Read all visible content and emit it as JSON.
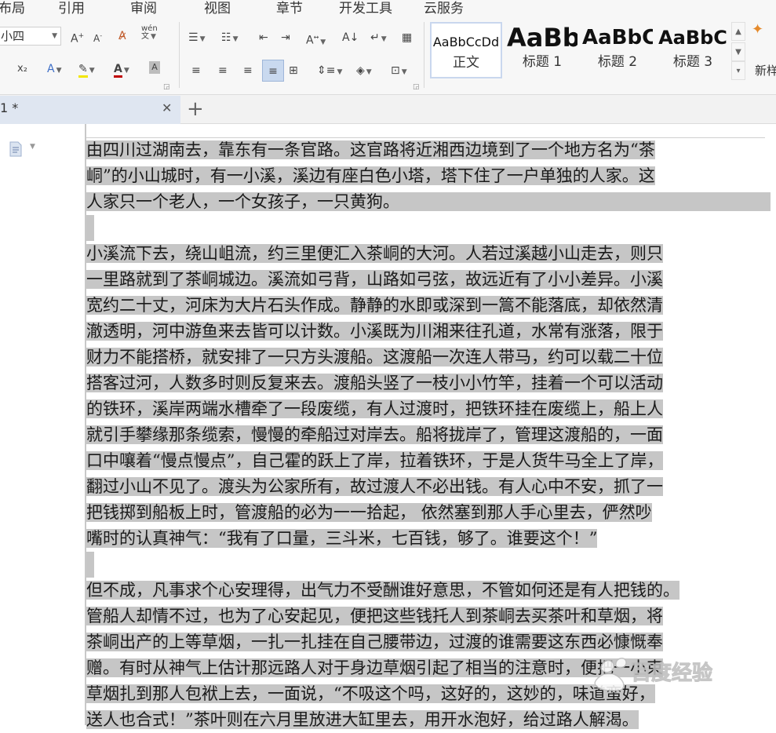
{
  "menu": [
    "布局",
    "引用",
    "审阅",
    "视图",
    "章节",
    "开发工具",
    "云服务"
  ],
  "ribbon": {
    "font_size": "小四",
    "pinyin_label": "wén",
    "superscript_label": "x₂",
    "styles": [
      {
        "preview": "AaBbCcDd",
        "name": "正文"
      },
      {
        "preview": "AaBb",
        "name": "标题 1"
      },
      {
        "preview": "AaBbC",
        "name": "标题 2"
      },
      {
        "preview": "AaBbC",
        "name": "标题 3"
      }
    ],
    "new_style_label": "新样"
  },
  "tab": {
    "title": "1 *"
  },
  "document": {
    "paragraphs": [
      [
        "由四川过湖南去，靠东有一条官路。这官路将近湘西边境到了一个地方名为“茶",
        "峒”的小山城时，有一小溪，溪边有座白色小塔，塔下住了一户单独的人家。这",
        "人家只一个老人，一个女孩子，一只黄狗。"
      ],
      [
        "小溪流下去，绕山岨流，约三里便汇入茶峒的大河。人若过溪越小山走去，则只",
        "一里路就到了茶峒城边。溪流如弓背，山路如弓弦，故远近有了小小差异。小溪",
        "宽约二十丈，河床为大片石头作成。静静的水即或深到一篙不能落底，却依然清",
        "澈透明，河中游鱼来去皆可以计数。小溪既为川湘来往孔道，水常有涨落，限于",
        "财力不能搭桥，就安排了一只方头渡船。这渡船一次连人带马，约可以载二十位",
        "搭客过河，人数多时则反复来去。渡船头竖了一枝小小竹竿，挂着一个可以活动",
        "的铁环，溪岸两端水槽牵了一段废缆，有人过渡时，把铁环挂在废缆上，船上人",
        "就引手攀缘那条缆索，慢慢的牵船过对岸去。船将拢岸了，管理这渡船的，一面",
        "口中嚷着“慢点慢点”，自己霍的跃上了岸，拉着铁环，于是人货牛马全上了岸，",
        "翻过小山不见了。渡头为公家所有，故过渡人不必出钱。有人心中不安，抓了一",
        "把钱掷到船板上时，管渡船的必为一一拾起， 依然塞到那人手心里去，俨然吵",
        "嘴时的认真神气：“我有了口量，三斗米，七百钱，够了。谁要这个！”"
      ],
      [
        "但不成，凡事求个心安理得，出气力不受酬谁好意思，不管如何还是有人把钱的。",
        "管船人却情不过，也为了心安起见，便把这些钱托人到茶峒去买茶叶和草烟，将",
        "茶峒出产的上等草烟，一扎一扎挂在自己腰带边，过渡的谁需要这东西必慷慨奉",
        "赠。有时从神气上估计那远路人对于身边草烟引起了相当的注意时，便把一小束",
        "草烟扎到那人包袱上去，一面说，“不吸这个吗，这好的，这妙的，味道蛮好，",
        "送人也合式！”茶叶则在六月里放进大缸里去，用开水泡好，给过路人解渴。"
      ]
    ]
  },
  "watermark": {
    "text": "百度经验"
  }
}
